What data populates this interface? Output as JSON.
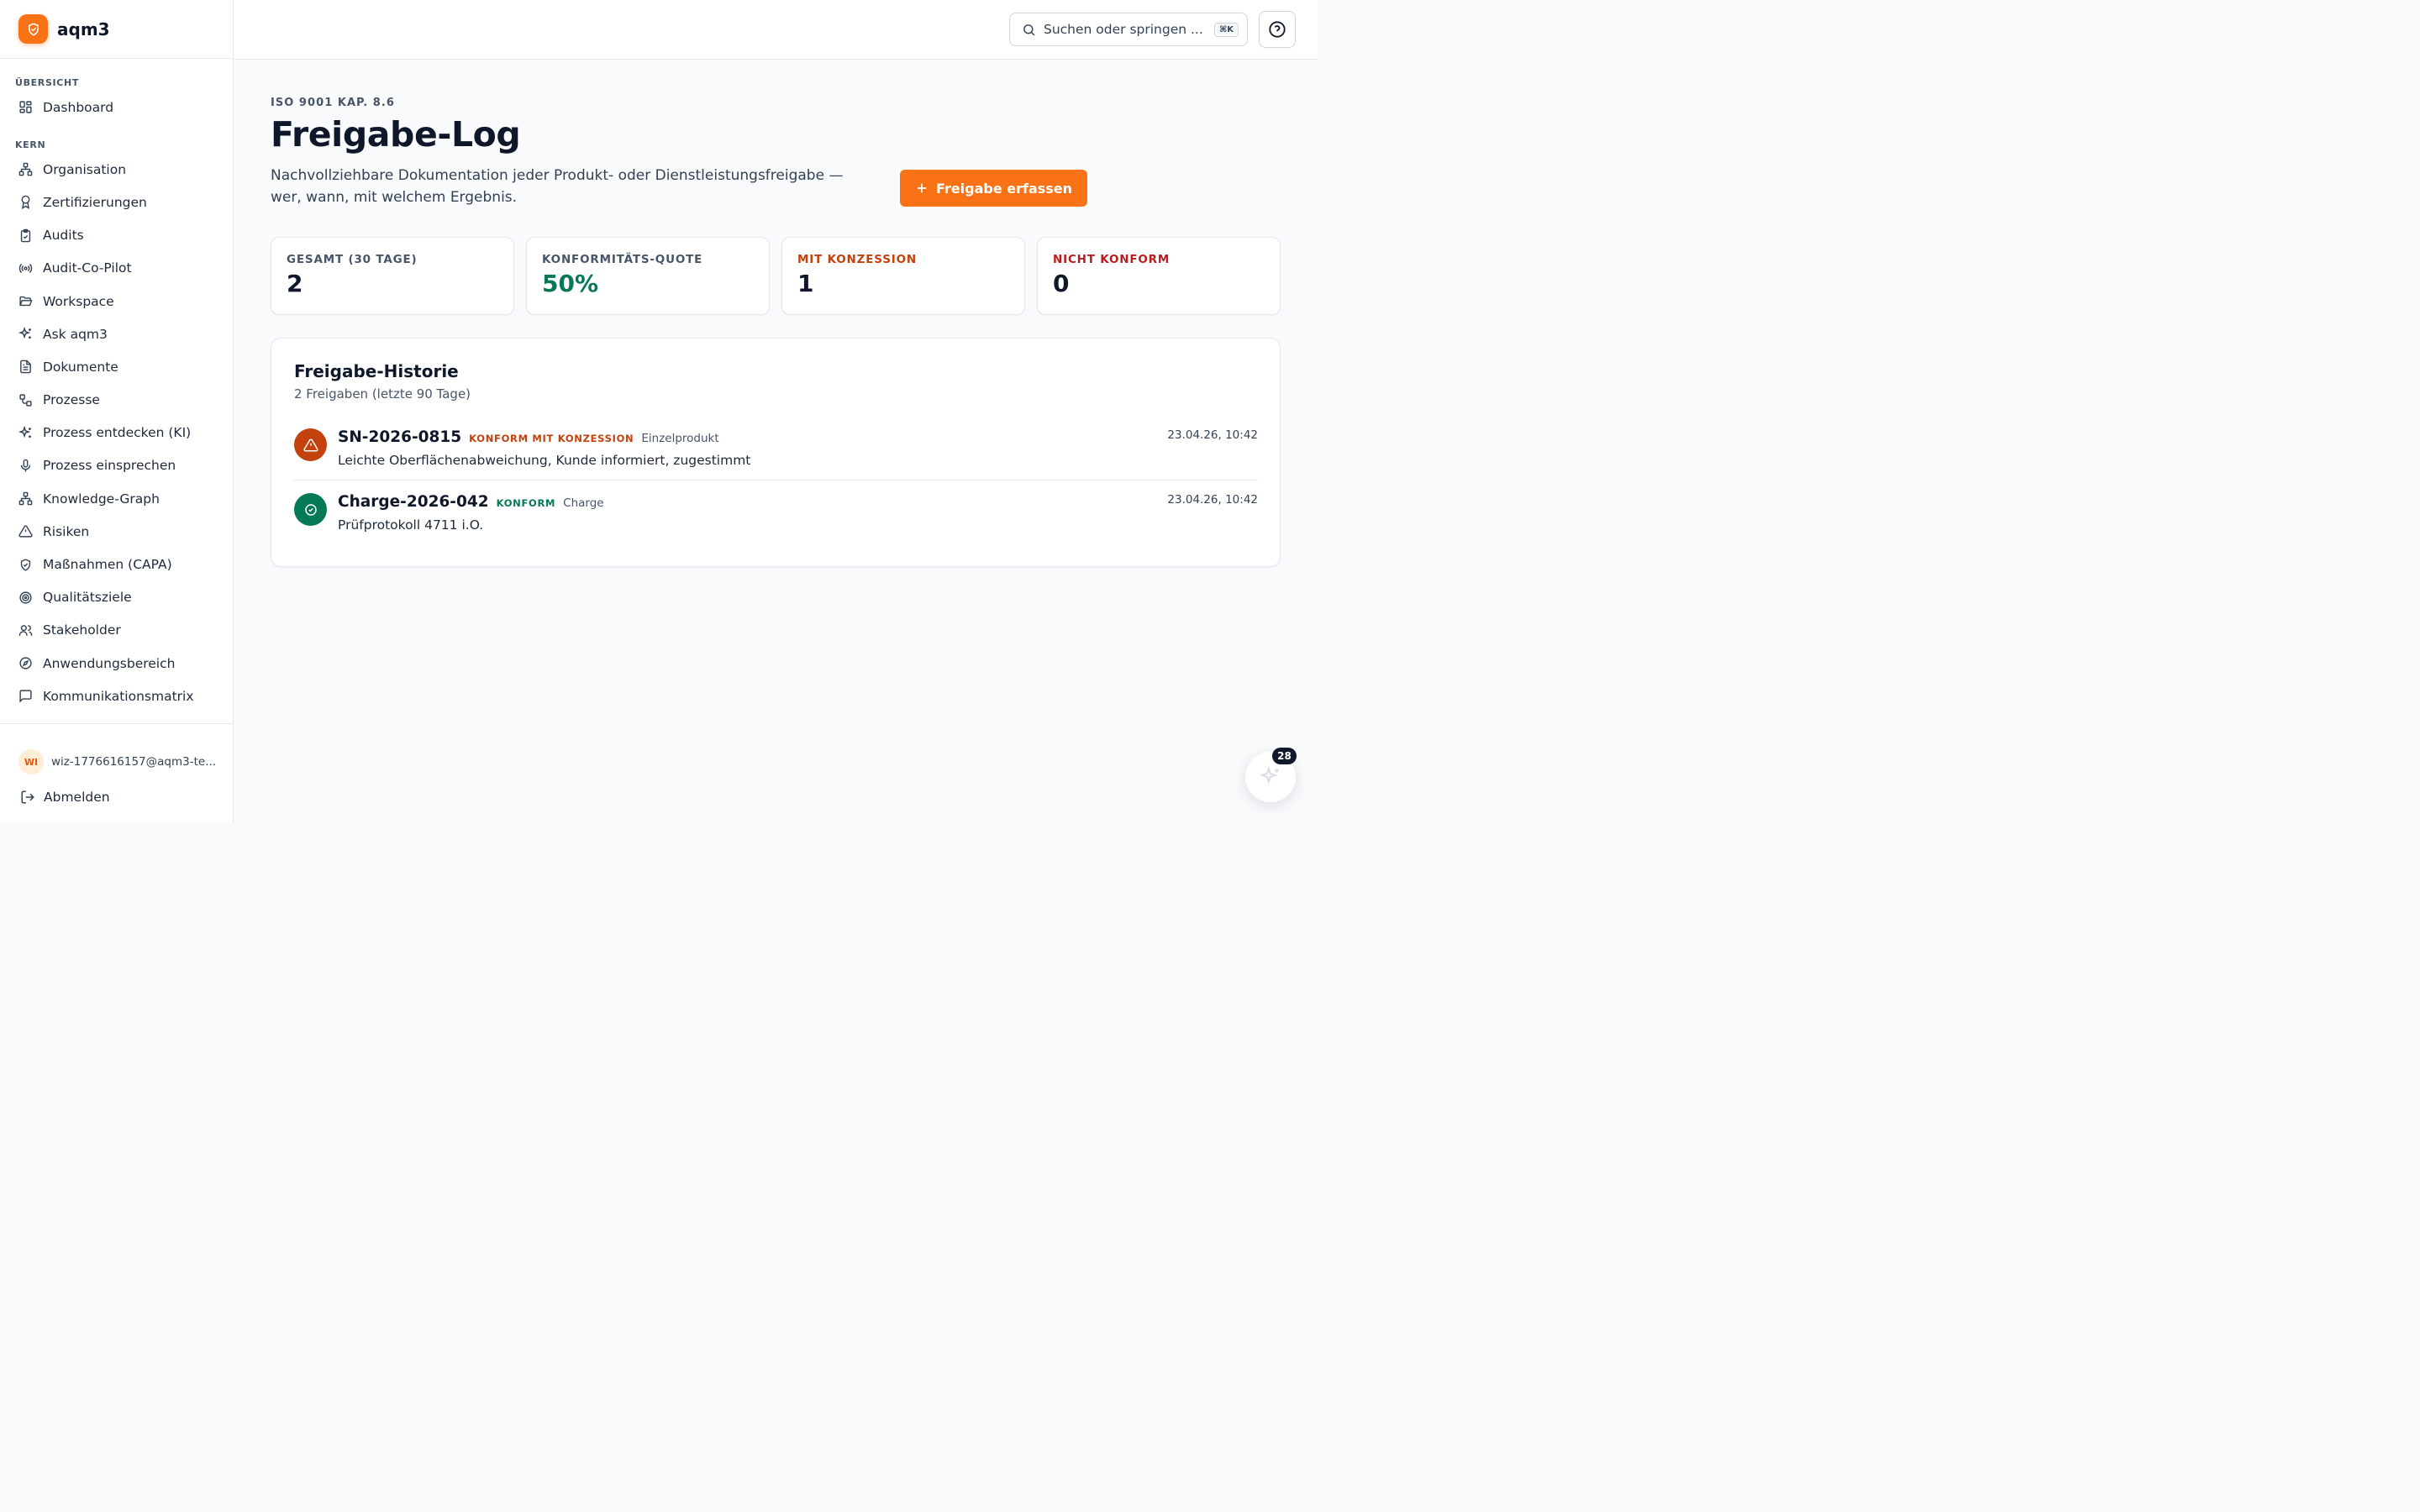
{
  "brand": {
    "name": "aqm3",
    "accent": "#f97316"
  },
  "sidebar": {
    "sections": [
      {
        "title": "ÜBERSICHT",
        "items": [
          {
            "label": "Dashboard",
            "icon": "dashboard-icon"
          }
        ]
      },
      {
        "title": "KERN",
        "items": [
          {
            "label": "Organisation",
            "icon": "org-chart-icon"
          },
          {
            "label": "Zertifizierungen",
            "icon": "award-icon"
          },
          {
            "label": "Audits",
            "icon": "clipboard-check-icon"
          },
          {
            "label": "Audit-Co-Pilot",
            "icon": "radio-icon"
          },
          {
            "label": "Workspace",
            "icon": "folder-open-icon"
          },
          {
            "label": "Ask aqm3",
            "icon": "sparkles-icon"
          },
          {
            "label": "Dokumente",
            "icon": "file-text-icon"
          },
          {
            "label": "Prozesse",
            "icon": "workflow-icon"
          },
          {
            "label": "Prozess entdecken (KI)",
            "icon": "sparkles-icon"
          },
          {
            "label": "Prozess einsprechen",
            "icon": "microphone-icon"
          },
          {
            "label": "Knowledge-Graph",
            "icon": "network-icon"
          },
          {
            "label": "Risiken",
            "icon": "warning-icon"
          },
          {
            "label": "Maßnahmen (CAPA)",
            "icon": "shield-check-icon"
          },
          {
            "label": "Qualitätsziele",
            "icon": "target-icon"
          },
          {
            "label": "Stakeholder",
            "icon": "users-icon"
          },
          {
            "label": "Anwendungsbereich",
            "icon": "compass-icon"
          },
          {
            "label": "Kommunikationsmatrix",
            "icon": "message-icon"
          }
        ]
      }
    ],
    "user": {
      "initials": "WI",
      "email": "wiz-1776616157@aqm3-te..."
    },
    "logout_label": "Abmelden"
  },
  "topbar": {
    "search_placeholder": "Suchen oder springen ...",
    "shortcut": "⌘K"
  },
  "page": {
    "eyebrow": "ISO 9001 KAP. 8.6",
    "title": "Freigabe-Log",
    "description": "Nachvollziehbare Dokumentation jeder Produkt- oder Dienstleistungsfreigabe — wer, wann, mit welchem Ergebnis.",
    "primary_button": "Freigabe erfassen"
  },
  "stats": [
    {
      "label": "GESAMT (30 TAGE)",
      "value": "2",
      "label_color": "#475569",
      "value_color": "#0f172a"
    },
    {
      "label": "KONFORMITÄTS-QUOTE",
      "value": "50%",
      "label_color": "#475569",
      "value_color": "#047857"
    },
    {
      "label": "MIT KONZESSION",
      "value": "1",
      "label_color": "#c2410c",
      "value_color": "#0f172a"
    },
    {
      "label": "NICHT KONFORM",
      "value": "0",
      "label_color": "#b91c1c",
      "value_color": "#0f172a"
    }
  ],
  "history": {
    "title": "Freigabe-Historie",
    "subtitle": "2 Freigaben (letzte 90 Tage)",
    "entries": [
      {
        "id": "SN-2026-0815",
        "status": "KONFORM MIT KONZESSION",
        "status_color": "#c2410c",
        "icon": "warning-icon",
        "icon_bg": "#c2410c",
        "type": "Einzelprodukt",
        "note": "Leichte Oberflächenabweichung, Kunde informiert, zugestimmt",
        "time": "23.04.26, 10:42"
      },
      {
        "id": "Charge-2026-042",
        "status": "KONFORM",
        "status_color": "#047857",
        "icon": "check-circle-icon",
        "icon_bg": "#047857",
        "type": "Charge",
        "note": "Prüfprotokoll 4711 i.O.",
        "time": "23.04.26, 10:42"
      }
    ]
  },
  "assistant": {
    "badge_count": "28"
  }
}
